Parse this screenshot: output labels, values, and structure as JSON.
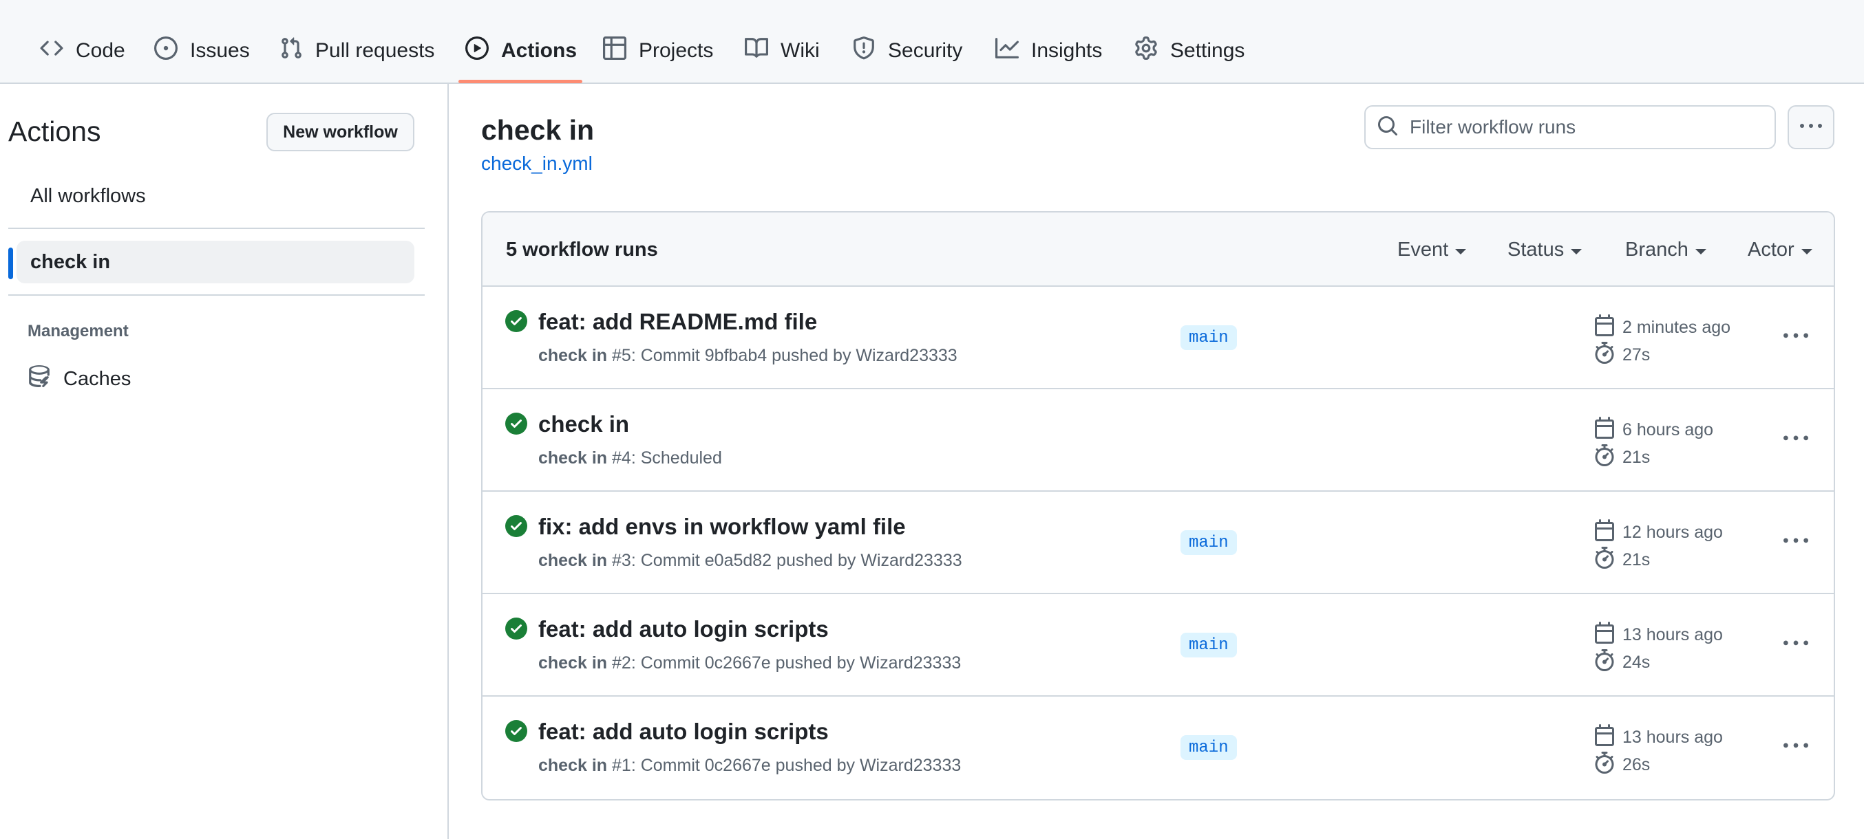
{
  "repo_nav": {
    "tabs": [
      {
        "label": "Code",
        "icon": "code-icon"
      },
      {
        "label": "Issues",
        "icon": "issue-opened-icon"
      },
      {
        "label": "Pull requests",
        "icon": "git-pull-request-icon"
      },
      {
        "label": "Actions",
        "icon": "play-icon",
        "selected": true
      },
      {
        "label": "Projects",
        "icon": "table-icon"
      },
      {
        "label": "Wiki",
        "icon": "book-icon"
      },
      {
        "label": "Security",
        "icon": "shield-icon"
      },
      {
        "label": "Insights",
        "icon": "graph-icon"
      },
      {
        "label": "Settings",
        "icon": "gear-icon"
      }
    ],
    "selected_underline_color": "#fd8c73"
  },
  "sidebar": {
    "title": "Actions",
    "new_workflow_label": "New workflow",
    "all_workflows_label": "All workflows",
    "workflows": [
      {
        "label": "check in",
        "active": true
      }
    ],
    "management_heading": "Management",
    "caches_label": "Caches",
    "caches_icon": "database-icon"
  },
  "workflow": {
    "title": "check in",
    "file_link": "check_in.yml",
    "filter_placeholder": "Filter workflow runs"
  },
  "runs": {
    "count_label": "5 workflow runs",
    "filters": [
      "Event",
      "Status",
      "Branch",
      "Actor"
    ],
    "items": [
      {
        "title": "feat: add README.md file",
        "workflow": "check in",
        "meta": " #5: Commit 9bfbab4 pushed by Wizard23333",
        "branch": "main",
        "when": "2 minutes ago",
        "duration": "27s",
        "status": "success"
      },
      {
        "title": "check in",
        "workflow": "check in",
        "meta": " #4: Scheduled",
        "branch": "",
        "when": "6 hours ago",
        "duration": "21s",
        "status": "success"
      },
      {
        "title": "fix: add envs in workflow yaml file",
        "workflow": "check in",
        "meta": " #3: Commit e0a5d82 pushed by Wizard23333",
        "branch": "main",
        "when": "12 hours ago",
        "duration": "21s",
        "status": "success"
      },
      {
        "title": "feat: add auto login scripts",
        "workflow": "check in",
        "meta": " #2: Commit 0c2667e pushed by Wizard23333",
        "branch": "main",
        "when": "13 hours ago",
        "duration": "24s",
        "status": "success"
      },
      {
        "title": "feat: add auto login scripts",
        "workflow": "check in",
        "meta": " #1: Commit 0c2667e pushed by Wizard23333",
        "branch": "main",
        "when": "13 hours ago",
        "duration": "26s",
        "status": "success"
      }
    ]
  },
  "colors": {
    "success": "#1a7f37",
    "link": "#0969da",
    "branch_bg": "#ddf4ff",
    "active_bar": "#0969da"
  }
}
